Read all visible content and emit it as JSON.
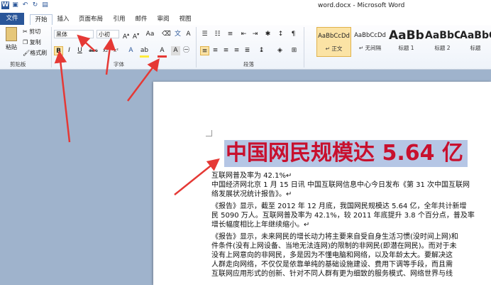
{
  "window": {
    "title": "word.docx - Microsoft Word"
  },
  "tabs": [
    "文件",
    "开始",
    "插入",
    "页面布局",
    "引用",
    "邮件",
    "审阅",
    "视图"
  ],
  "clipboard": {
    "paste": "粘贴",
    "cut": "剪切",
    "copy": "复制",
    "format_painter": "格式刷",
    "group": "剪贴板"
  },
  "font": {
    "family": "黑体",
    "size": "小初",
    "group": "字体"
  },
  "paragraph": {
    "group": "段落"
  },
  "styles": [
    {
      "preview": "AaBbCcDd",
      "name": "↵ 正文"
    },
    {
      "preview": "AaBbCcDd",
      "name": "↵ 无间隔"
    },
    {
      "preview": "AaBb",
      "name": "标题 1"
    },
    {
      "preview": "AaBbC",
      "name": "标题 2"
    },
    {
      "preview": "AaBbC",
      "name": "标题"
    }
  ],
  "document": {
    "heading": "中国网民规模达 5.64 亿",
    "lines": [
      "互联网普及率为 42.1%↵",
      "中国经济网北京 1 月 15 日讯  中国互联网信息中心今日发布《第 31 次中国互联网",
      "络发展状况统计报告》。↵",
      "《报告》显示，截至 2012 年 12 月底，我国网民规模达 5.64 亿，全年共计新增",
      "民 5090 万人。互联网普及率为 42.1%，较 2011 年底提升 3.8 个百分点，普及率",
      "增长幅度相比上年继续缩小。↵",
      "《报告》显示，未来网民的增长动力将主要来自受自身生活习惯(没时间上网)和",
      "件条件(没有上网设备、当地无法连网)的限制的非网民(即潜在网民)。而对于未",
      "没有上网意向的非网民，多是因为不懂电脑和网络，以及年龄太大。要解决这",
      "人群走向网络，不仅仅是依靠单纯的基础设施建设、费用下调等手段，而且需",
      "互联网应用形式的创新、针对不同人群有更为细致的服务模式、网络世界与线"
    ]
  },
  "colors": {
    "file_tab": "#2a5699",
    "heading": "#c8102e",
    "highlight": "#b5c6e5",
    "arrow": "#e53935",
    "workspace": "#9fb3cc"
  }
}
